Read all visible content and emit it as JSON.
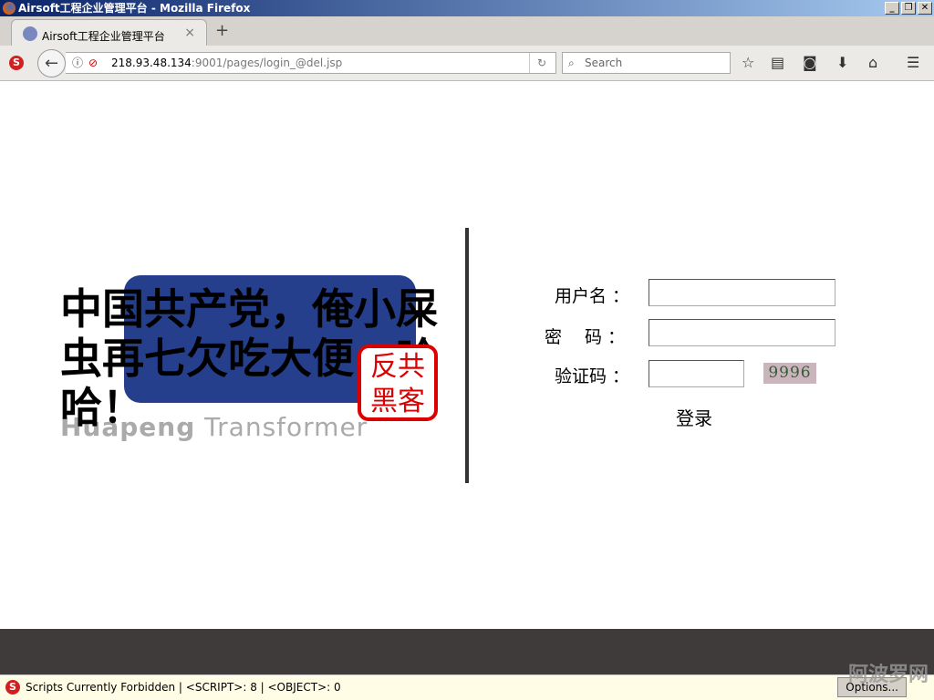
{
  "window": {
    "title": "Airsoft工程企业管理平台 - Mozilla Firefox",
    "controls": [
      "_",
      "❐",
      "✕"
    ]
  },
  "tab": {
    "label": "Airsoft工程企业管理平台",
    "close": "×",
    "new_tab": "+"
  },
  "nav": {
    "url_host": "218.93.48.134",
    "url_rest": ":9001/pages/login_@del.jsp",
    "search_placeholder": "Search"
  },
  "logo": {
    "brand_bold": "Huapeng",
    "brand_thin": " Transformer",
    "slogan": "中国共产党，俺小屎虫再七欠吃大便，哈哈！",
    "seal_text": "反共黑客"
  },
  "form": {
    "username_label": "用户名 ：",
    "password_label": "密　 码 ：",
    "captcha_label": "验证码 ：",
    "username_value": "",
    "password_value": "",
    "captcha_value": "",
    "captcha_image_text": "9996",
    "submit_label": "登录"
  },
  "status": {
    "text": "Scripts Currently Forbidden | <SCRIPT>: 8 | <OBJECT>: 0",
    "options_label": "Options...",
    "watermark": "阿波罗网"
  },
  "colors": {
    "titlebar": "#0a246a",
    "footer": "#3f3b3a",
    "seal": "#dd0000",
    "logo_blue": "#253f8c"
  }
}
